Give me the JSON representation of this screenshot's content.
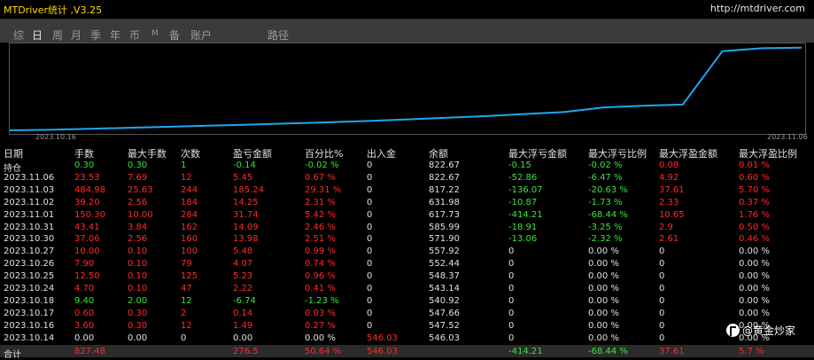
{
  "window": {
    "title": "MTDriver统计 ,V3.25",
    "url": "http://mtdriver.com"
  },
  "tabs": [
    {
      "label": "综",
      "active": false
    },
    {
      "label": "日",
      "active": true
    },
    {
      "label": "周",
      "active": false
    },
    {
      "label": "月",
      "active": false
    },
    {
      "label": "季",
      "active": false
    },
    {
      "label": "年",
      "active": false
    },
    {
      "label": "币",
      "active": false
    },
    {
      "label": "M",
      "active": false
    },
    {
      "label": "备",
      "active": false
    },
    {
      "label": "账户",
      "active": false
    },
    {
      "label": "路径",
      "active": false
    }
  ],
  "chart_data": {
    "type": "line",
    "x_start_label": "2023.10.16",
    "x_end_label": "2023.11.06",
    "series": [
      {
        "values": [
          0.0,
          0.7,
          1.8,
          3.1,
          4.2,
          5.6,
          6.8,
          8.2,
          9.6,
          11.2,
          13.0,
          15.0,
          17.0,
          19.5,
          22.0,
          27.5,
          29.5,
          31.0,
          95.0,
          98.5,
          99.2
        ]
      }
    ],
    "ylim": [
      0,
      100
    ],
    "line_color": "#1ea7f0"
  },
  "columns": [
    "日期",
    "手数",
    "最大手数",
    "次数",
    "盈亏金额",
    "百分比%",
    "出入金",
    "余额",
    "最大浮亏金额",
    "最大浮亏比例",
    "最大浮盈金额",
    "最大浮盈比例"
  ],
  "rows": [
    {
      "cells": [
        "持仓",
        "0.30",
        "0.30",
        "1",
        "-0.14",
        "-0.02 %",
        "0",
        "822.67",
        "-0.15",
        "-0.02 %",
        "0.08",
        "0.01 %"
      ],
      "colors": [
        "w",
        "g",
        "g",
        "g",
        "g",
        "g",
        "w",
        "w",
        "g",
        "g",
        "r",
        "r"
      ]
    },
    {
      "cells": [
        "2023.11.06",
        "23.53",
        "7.69",
        "12",
        "5.45",
        "0.67 %",
        "0",
        "822.67",
        "-52.86",
        "-6.47 %",
        "4.92",
        "0.60 %"
      ],
      "colors": [
        "w",
        "r",
        "r",
        "r",
        "r",
        "r",
        "w",
        "w",
        "g",
        "g",
        "r",
        "r"
      ]
    },
    {
      "cells": [
        "2023.11.03",
        "484.98",
        "25.63",
        "244",
        "185.24",
        "29.31 %",
        "0",
        "817.22",
        "-136.07",
        "-20.63 %",
        "37.61",
        "5.70 %"
      ],
      "colors": [
        "w",
        "r",
        "r",
        "r",
        "r",
        "r",
        "w",
        "w",
        "g",
        "g",
        "r",
        "r"
      ]
    },
    {
      "cells": [
        "2023.11.02",
        "39.20",
        "2.56",
        "184",
        "14.25",
        "2.31 %",
        "0",
        "631.98",
        "-10.87",
        "-1.73 %",
        "2.33",
        "0.37 %"
      ],
      "colors": [
        "w",
        "r",
        "r",
        "r",
        "r",
        "r",
        "w",
        "w",
        "g",
        "g",
        "r",
        "r"
      ]
    },
    {
      "cells": [
        "2023.11.01",
        "150.30",
        "10.00",
        "284",
        "31.74",
        "5.42 %",
        "0",
        "617.73",
        "-414.21",
        "-68.44 %",
        "10.65",
        "1.76 %"
      ],
      "colors": [
        "w",
        "r",
        "r",
        "r",
        "r",
        "r",
        "w",
        "w",
        "g",
        "g",
        "r",
        "r"
      ]
    },
    {
      "cells": [
        "2023.10.31",
        "43.41",
        "3.84",
        "162",
        "14.09",
        "2.46 %",
        "0",
        "585.99",
        "-18.91",
        "-3.25 %",
        "2.9",
        "0.50 %"
      ],
      "colors": [
        "w",
        "r",
        "r",
        "r",
        "r",
        "r",
        "w",
        "w",
        "g",
        "g",
        "r",
        "r"
      ]
    },
    {
      "cells": [
        "2023.10.30",
        "37.06",
        "2.56",
        "160",
        "13.98",
        "2.51 %",
        "0",
        "571.90",
        "-13.06",
        "-2.32 %",
        "2.61",
        "0.46 %"
      ],
      "colors": [
        "w",
        "r",
        "r",
        "r",
        "r",
        "r",
        "w",
        "w",
        "g",
        "g",
        "r",
        "r"
      ]
    },
    {
      "cells": [
        "2023.10.27",
        "10.00",
        "0.10",
        "100",
        "5.48",
        "0.99 %",
        "0",
        "557.92",
        "0",
        "0.00 %",
        "0",
        "0.00 %"
      ],
      "colors": [
        "w",
        "r",
        "r",
        "r",
        "r",
        "r",
        "w",
        "w",
        "w",
        "w",
        "w",
        "w"
      ]
    },
    {
      "cells": [
        "2023.10.26",
        "7.90",
        "0.10",
        "79",
        "4.07",
        "0.74 %",
        "0",
        "552.44",
        "0",
        "0.00 %",
        "0",
        "0.00 %"
      ],
      "colors": [
        "w",
        "r",
        "r",
        "r",
        "r",
        "r",
        "w",
        "w",
        "w",
        "w",
        "w",
        "w"
      ]
    },
    {
      "cells": [
        "2023.10.25",
        "12.50",
        "0.10",
        "125",
        "5.23",
        "0.96 %",
        "0",
        "548.37",
        "0",
        "0.00 %",
        "0",
        "0.00 %"
      ],
      "colors": [
        "w",
        "r",
        "r",
        "r",
        "r",
        "r",
        "w",
        "w",
        "w",
        "w",
        "w",
        "w"
      ]
    },
    {
      "cells": [
        "2023.10.24",
        "4.70",
        "0.10",
        "47",
        "2.22",
        "0.41 %",
        "0",
        "543.14",
        "0",
        "0.00 %",
        "0",
        "0.00 %"
      ],
      "colors": [
        "w",
        "r",
        "r",
        "r",
        "r",
        "r",
        "w",
        "w",
        "w",
        "w",
        "w",
        "w"
      ]
    },
    {
      "cells": [
        "2023.10.18",
        "9.40",
        "2.00",
        "12",
        "-6.74",
        "-1.23 %",
        "0",
        "540.92",
        "0",
        "0.00 %",
        "0",
        "0.00 %"
      ],
      "colors": [
        "w",
        "g",
        "g",
        "g",
        "g",
        "g",
        "w",
        "w",
        "w",
        "w",
        "w",
        "w"
      ]
    },
    {
      "cells": [
        "2023.10.17",
        "0.60",
        "0.30",
        "2",
        "0.14",
        "0.03 %",
        "0",
        "547.66",
        "0",
        "0.00 %",
        "0",
        "0.00 %"
      ],
      "colors": [
        "w",
        "r",
        "r",
        "r",
        "r",
        "r",
        "w",
        "w",
        "w",
        "w",
        "w",
        "w"
      ]
    },
    {
      "cells": [
        "2023.10.16",
        "3.60",
        "0.30",
        "12",
        "1.49",
        "0.27 %",
        "0",
        "547.52",
        "0",
        "0.00 %",
        "0",
        "0.00 %"
      ],
      "colors": [
        "w",
        "r",
        "r",
        "r",
        "r",
        "r",
        "w",
        "w",
        "w",
        "w",
        "w",
        "w"
      ]
    },
    {
      "cells": [
        "2023.10.14",
        "0.00",
        "0.00",
        "0",
        "0.00",
        "0.00 %",
        "546.03",
        "546.03",
        "0",
        "0.00 %",
        "0",
        "0.00 %"
      ],
      "colors": [
        "w",
        "w",
        "w",
        "w",
        "w",
        "w",
        "r",
        "w",
        "w",
        "w",
        "w",
        "w"
      ]
    }
  ],
  "total": {
    "cells": [
      "合计",
      "827.48",
      "",
      "",
      "276.5",
      "50.64 %",
      "546.03",
      "",
      "-414.21",
      "-68.44 %",
      "37.61",
      "5.7 %"
    ],
    "colors": [
      "w",
      "r",
      "w",
      "w",
      "r",
      "r",
      "r",
      "w",
      "g",
      "g",
      "r",
      "r"
    ]
  },
  "watermark": {
    "text": "@黄金炒家"
  }
}
